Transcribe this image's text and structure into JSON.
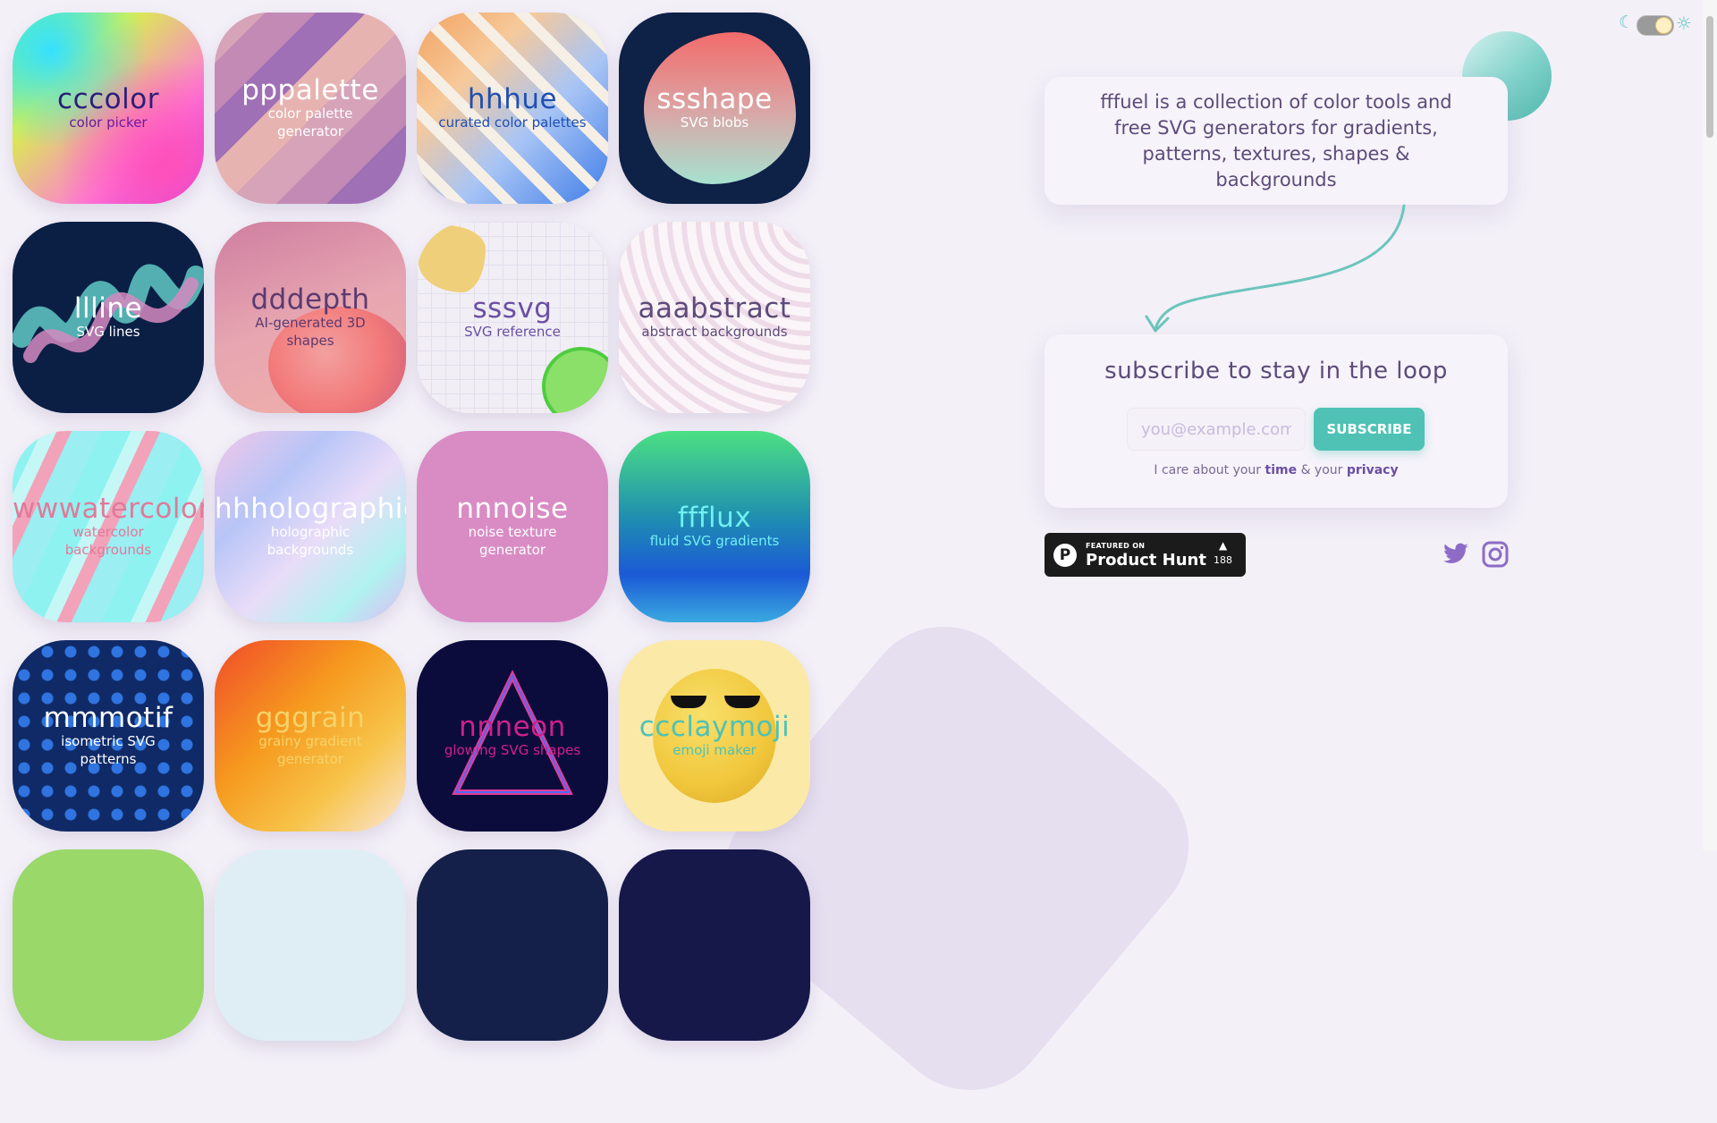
{
  "tiles": [
    {
      "name": "cccolor",
      "sub": "color picker"
    },
    {
      "name": "pppalette",
      "sub": "color palette generator"
    },
    {
      "name": "hhhue",
      "sub": "curated color palettes"
    },
    {
      "name": "ssshape",
      "sub": "SVG blobs"
    },
    {
      "name": "llline",
      "sub": "SVG lines"
    },
    {
      "name": "dddepth",
      "sub": "AI-generated 3D shapes"
    },
    {
      "name": "sssvg",
      "sub": "SVG reference"
    },
    {
      "name": "aaabstract",
      "sub": "abstract backgrounds"
    },
    {
      "name": "wwwatercolor",
      "sub": "watercolor backgrounds"
    },
    {
      "name": "hhholographic",
      "sub": "holographic backgrounds"
    },
    {
      "name": "nnnoise",
      "sub": "noise texture generator"
    },
    {
      "name": "ffflux",
      "sub": "fluid SVG gradients"
    },
    {
      "name": "mmmotif",
      "sub": "isometric SVG patterns"
    },
    {
      "name": "gggrain",
      "sub": "grainy gradient generator"
    },
    {
      "name": "nnneon",
      "sub": "glowing SVG shapes"
    },
    {
      "name": "ccclaymoji",
      "sub": "emoji maker"
    }
  ],
  "intro": {
    "text": "fffuel is a collection of color tools and free SVG generators for gradients, patterns, textures, shapes & backgrounds"
  },
  "subscribe": {
    "title": "subscribe to stay in the loop",
    "placeholder": "you@example.com",
    "button": "SUBSCRIBE",
    "care_prefix": "I care about your",
    "care_time": "time",
    "care_mid": "& your",
    "care_privacy": "privacy"
  },
  "producthunt": {
    "featured": "FEATURED ON",
    "name": "Product Hunt",
    "count": "188",
    "logo_letter": "P"
  },
  "icons": {
    "moon": "☾",
    "sun": "☼",
    "upvote": "▲"
  },
  "theme": {
    "accent": "#4fc2b5",
    "text": "#5d4b79",
    "background": "#f3f0f8"
  }
}
